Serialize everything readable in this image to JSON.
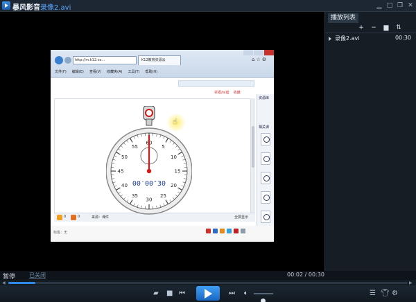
{
  "window": {
    "app_name": "暴风影音",
    "file_name": "录像2.avi",
    "controls": [
      "minimize-icon",
      "maximize-icon",
      "restore-icon",
      "close-icon"
    ]
  },
  "video": {
    "browser": {
      "address": "http://m.k12.co...",
      "tab_label": "K12教育资源云",
      "menu": [
        "文件(F)",
        "编辑(E)",
        "查看(V)",
        "收藏夹(A)",
        "工具(T)",
        "帮助(H)"
      ],
      "page_links": [
        "举报/纠错",
        "收藏"
      ],
      "sidebar_heading": "资源库",
      "sidebar_subheading": "相关课",
      "likes": "0",
      "dislikes": "0",
      "source": "来源：课件",
      "fullscreen_label": "全屏显示",
      "footer_label": "标签：无",
      "share_colors": [
        "#d0302c",
        "#2b6cc8",
        "#e88a1a",
        "#33a0e0",
        "#c02020",
        "#8a9aa8"
      ]
    },
    "stopwatch": {
      "reading": "00′00″30",
      "dial_numbers": [
        "60",
        "5",
        "10",
        "15",
        "20",
        "25",
        "30",
        "35",
        "40",
        "45",
        "50",
        "55"
      ],
      "colors": {
        "hand": "#d11a1a",
        "crown": "#d11a1a",
        "digits": "#1d3da0"
      }
    }
  },
  "playlist": {
    "tab_label": "播放列表",
    "toolbar": [
      "add-icon",
      "remove-icon",
      "trash-icon",
      "sort-icon"
    ],
    "items": [
      {
        "name": "录像2.avi",
        "duration": "00:30"
      }
    ]
  },
  "status": {
    "state": "暂停",
    "subtitle": "已关闭",
    "current_time": "00:02",
    "total_time": "00:30",
    "separator": "/"
  },
  "seek": {
    "progress": 0.067
  },
  "volume": {
    "level": 0.45
  },
  "accent": "#2f8be6"
}
